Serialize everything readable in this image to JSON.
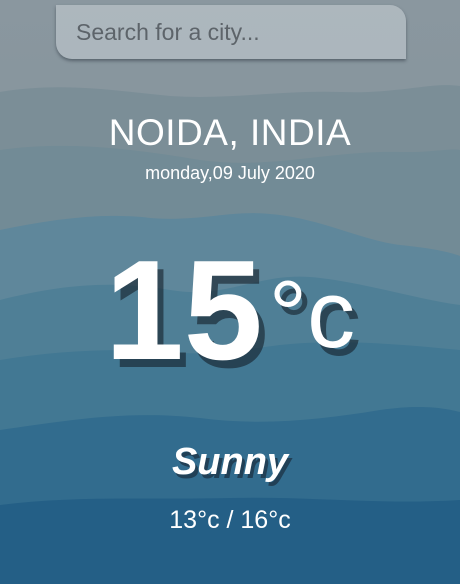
{
  "search": {
    "placeholder": "Search for a city..."
  },
  "location": "NOIDA, INDIA",
  "date": "monday,09 July 2020",
  "temperature": {
    "value": "15",
    "unit": "°c"
  },
  "condition": "Sunny",
  "range": "13°c / 16°c",
  "colors": {
    "sky": "#8a9aa3",
    "mountain_near": "#1f5f86",
    "text": "#ffffff"
  }
}
